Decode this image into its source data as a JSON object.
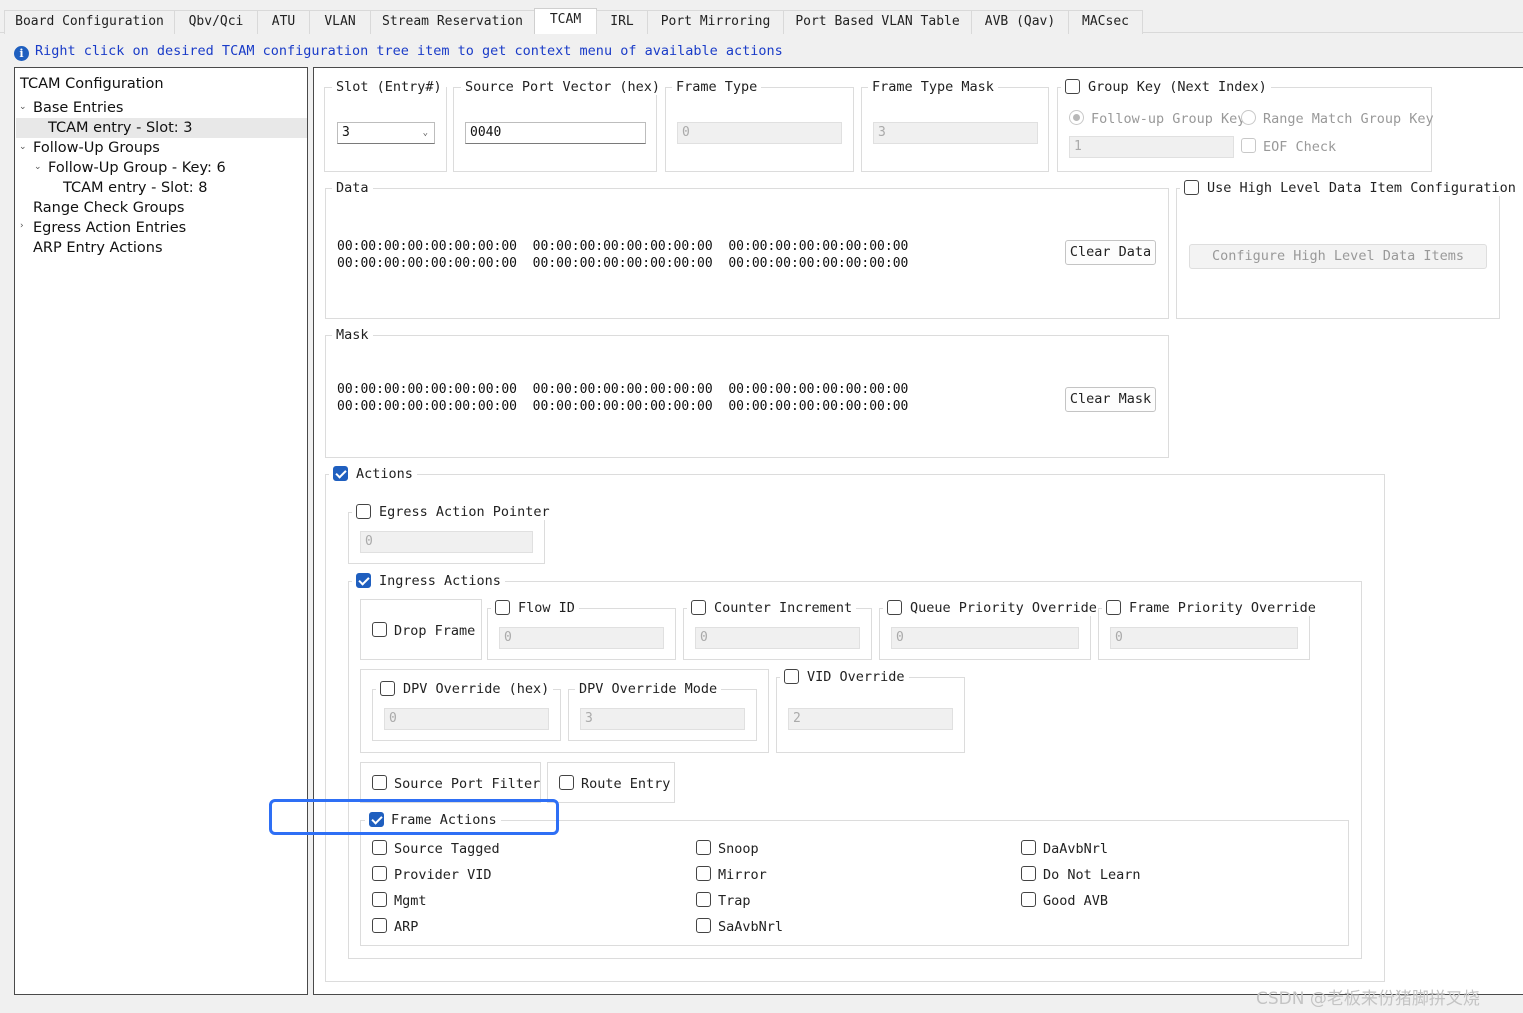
{
  "tabs": [
    "Board Configuration",
    "Qbv/Qci",
    "ATU",
    "VLAN",
    "Stream Reservation",
    "TCAM",
    "IRL",
    "Port Mirroring",
    "Port Based VLAN Table",
    "AVB (Qav)",
    "MACsec"
  ],
  "active_tab": "TCAM",
  "info_text": "Right click on desired TCAM configuration tree item to get context menu of available actions",
  "tree": {
    "root": "TCAM Configuration",
    "base_entries": "Base Entries",
    "base_entry": "TCAM entry - Slot: 3",
    "followup_groups": "Follow-Up Groups",
    "followup_group": "Follow-Up Group - Key: 6",
    "followup_entry": "TCAM entry - Slot: 8",
    "range_check": "Range Check Groups",
    "egress_entries": "Egress Action Entries",
    "arp_actions": "ARP Entry Actions"
  },
  "slot": {
    "label": "Slot (Entry#)",
    "value": "3"
  },
  "source_port_vector": {
    "label": "Source Port Vector (hex)",
    "value": "0040"
  },
  "frame_type": {
    "label": "Frame Type",
    "value": "0"
  },
  "frame_type_mask": {
    "label": "Frame Type Mask",
    "value": "3"
  },
  "group_key": {
    "label": "Group Key (Next Index)",
    "checked": false,
    "followup_label": "Follow-up Group Key",
    "range_label": "Range Match Group Key",
    "value": "1",
    "eof_label": "EOF Check"
  },
  "data": {
    "label": "Data",
    "lines": [
      "00:00:00:00:00:00:00:00  00:00:00:00:00:00:00:00  00:00:00:00:00:00:00:00",
      "00:00:00:00:00:00:00:00  00:00:00:00:00:00:00:00  00:00:00:00:00:00:00:00"
    ],
    "clear_label": "Clear Data"
  },
  "high_level": {
    "label": "Use High Level Data Item Configuration",
    "button": "Configure High Level Data Items"
  },
  "mask": {
    "label": "Mask",
    "lines": [
      "00:00:00:00:00:00:00:00  00:00:00:00:00:00:00:00  00:00:00:00:00:00:00:00",
      "00:00:00:00:00:00:00:00  00:00:00:00:00:00:00:00  00:00:00:00:00:00:00:00"
    ],
    "clear_label": "Clear Mask"
  },
  "actions": {
    "label": "Actions",
    "checked": true
  },
  "egress_pointer": {
    "label": "Egress Action Pointer",
    "value": "0"
  },
  "ingress": {
    "label": "Ingress Actions",
    "checked": true
  },
  "drop_frame": {
    "label": "Drop Frame"
  },
  "flow_id": {
    "label": "Flow ID",
    "value": "0"
  },
  "counter_increment": {
    "label": "Counter Increment",
    "value": "0"
  },
  "queue_priority": {
    "label": "Queue Priority Override",
    "value": "0"
  },
  "frame_priority": {
    "label": "Frame Priority Override",
    "value": "0"
  },
  "dpv_override": {
    "label": "DPV Override (hex)",
    "value": "0"
  },
  "dpv_mode": {
    "label": "DPV Override Mode",
    "value": "3"
  },
  "vid_override": {
    "label": "VID Override",
    "value": "2"
  },
  "source_port_filter": {
    "label": "Source Port Filter"
  },
  "route_entry": {
    "label": "Route Entry"
  },
  "frame_actions": {
    "label": "Frame Actions",
    "checked": true,
    "items": [
      "Source Tagged",
      "Provider VID",
      "Mgmt",
      "ARP",
      "Snoop",
      "Mirror",
      "Trap",
      "SaAvbNrl",
      "DaAvbNrl",
      "Do Not Learn",
      "Good AVB"
    ]
  },
  "watermark": "CSDN @老板来份猪脚拼叉烧",
  "colors": {
    "accent": "#1f5fbf",
    "highlight": "#2e6ff5",
    "info_text": "#1a3cc8"
  }
}
